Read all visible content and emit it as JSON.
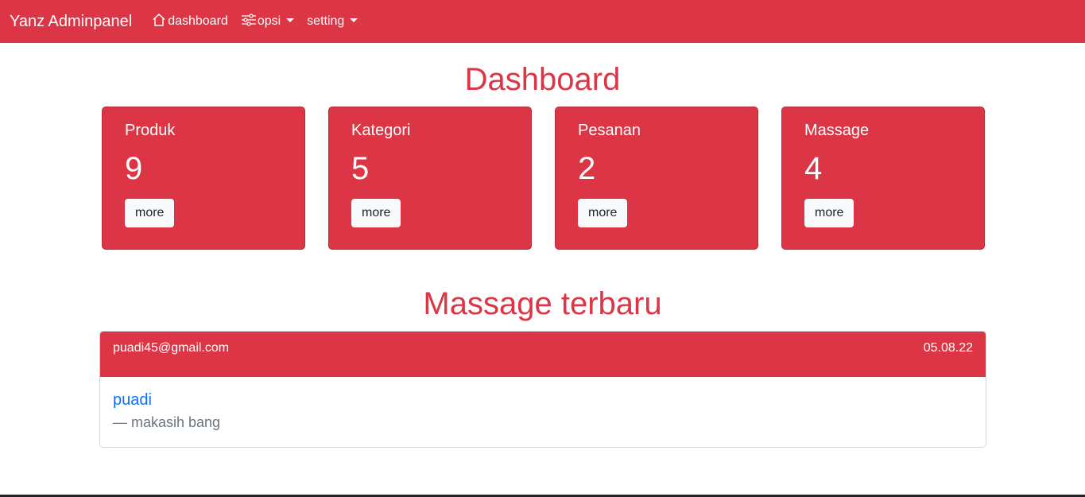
{
  "navbar": {
    "brand": "Yanz Adminpanel",
    "links": [
      {
        "label": "dashboard",
        "icon": "house-icon"
      },
      {
        "label": "opsi",
        "icon": "sliders-icon",
        "dropdown": true
      },
      {
        "label": "setting",
        "dropdown": true
      }
    ],
    "color": "#dc3545"
  },
  "page_title": "Dashboard",
  "cards": [
    {
      "label": "Produk",
      "count": "9",
      "button": "more"
    },
    {
      "label": "Kategori",
      "count": "5",
      "button": "more"
    },
    {
      "label": "Pesanan",
      "count": "2",
      "button": "more"
    },
    {
      "label": "Massage",
      "count": "4",
      "button": "more"
    }
  ],
  "messages_section": {
    "title": "Massage terbaru",
    "items": [
      {
        "email": "puadi45@gmail.com",
        "date": "05.08.22",
        "name": "puadi",
        "text": "— makasih bang"
      }
    ]
  }
}
